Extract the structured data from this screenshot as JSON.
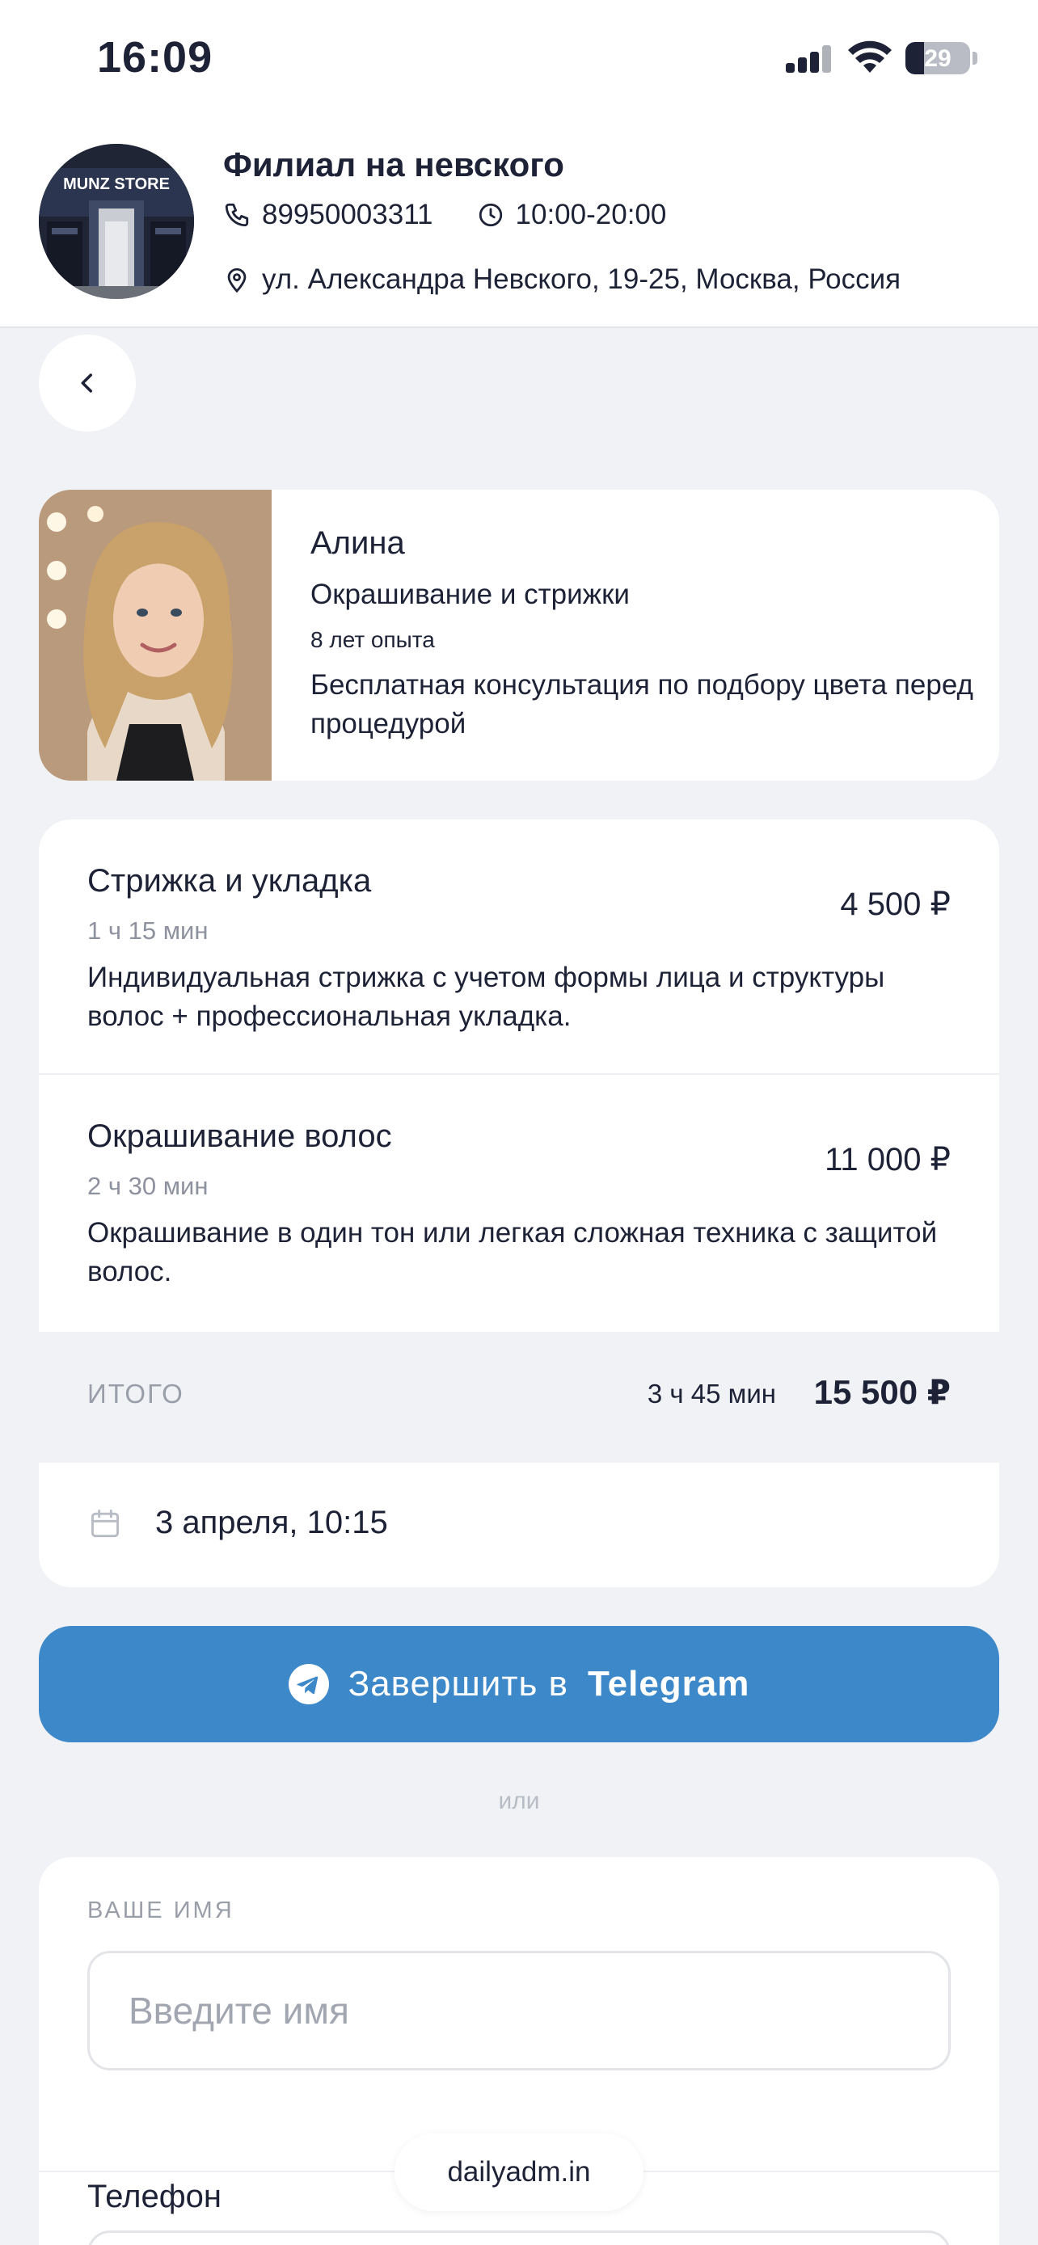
{
  "status_bar": {
    "time": "16:09",
    "battery_level": "29",
    "battery_fraction": 0.29
  },
  "branch": {
    "name": "Филиал на невского",
    "phone": "89950003311",
    "hours": "10:00-20:00",
    "address": "ул. Александра Невского, 19-25, Москва, Россия",
    "logo_text": "MUNZ STORE"
  },
  "master": {
    "name": "Алина",
    "specialty": "Окрашивание и стрижки",
    "experience": "8 лет опыта",
    "note": "Бесплатная консультация по подбору цвета перед процедурой"
  },
  "services": [
    {
      "title": "Стрижка и укладка",
      "duration": "1 ч 15 мин",
      "price": "4 500 ₽",
      "description": "Индивидуальная стрижка с учетом формы лица и структуры волос + профессиональная укладка."
    },
    {
      "title": "Окрашивание волос",
      "duration": "2 ч 30 мин",
      "price": "11 000 ₽",
      "description": "Окрашивание в один тон или легкая сложная техника с защитой волос."
    }
  ],
  "total": {
    "label": "ИТОГО",
    "duration": "3 ч 45 мин",
    "price": "15 500 ₽"
  },
  "appointment": {
    "datetime": "3 апреля, 10:15"
  },
  "telegram_button": {
    "prefix": "Завершить в",
    "brand": "Telegram"
  },
  "separator_text": "или",
  "form": {
    "name_label": "ВАШЕ ИМЯ",
    "name_placeholder": "Введите имя",
    "phone_label": "Телефон"
  },
  "watermark": "dailyadm.in",
  "colors": {
    "accent": "#3d88c8",
    "text": "#1e2236",
    "muted": "#8e929e",
    "background": "#f1f2f5"
  }
}
